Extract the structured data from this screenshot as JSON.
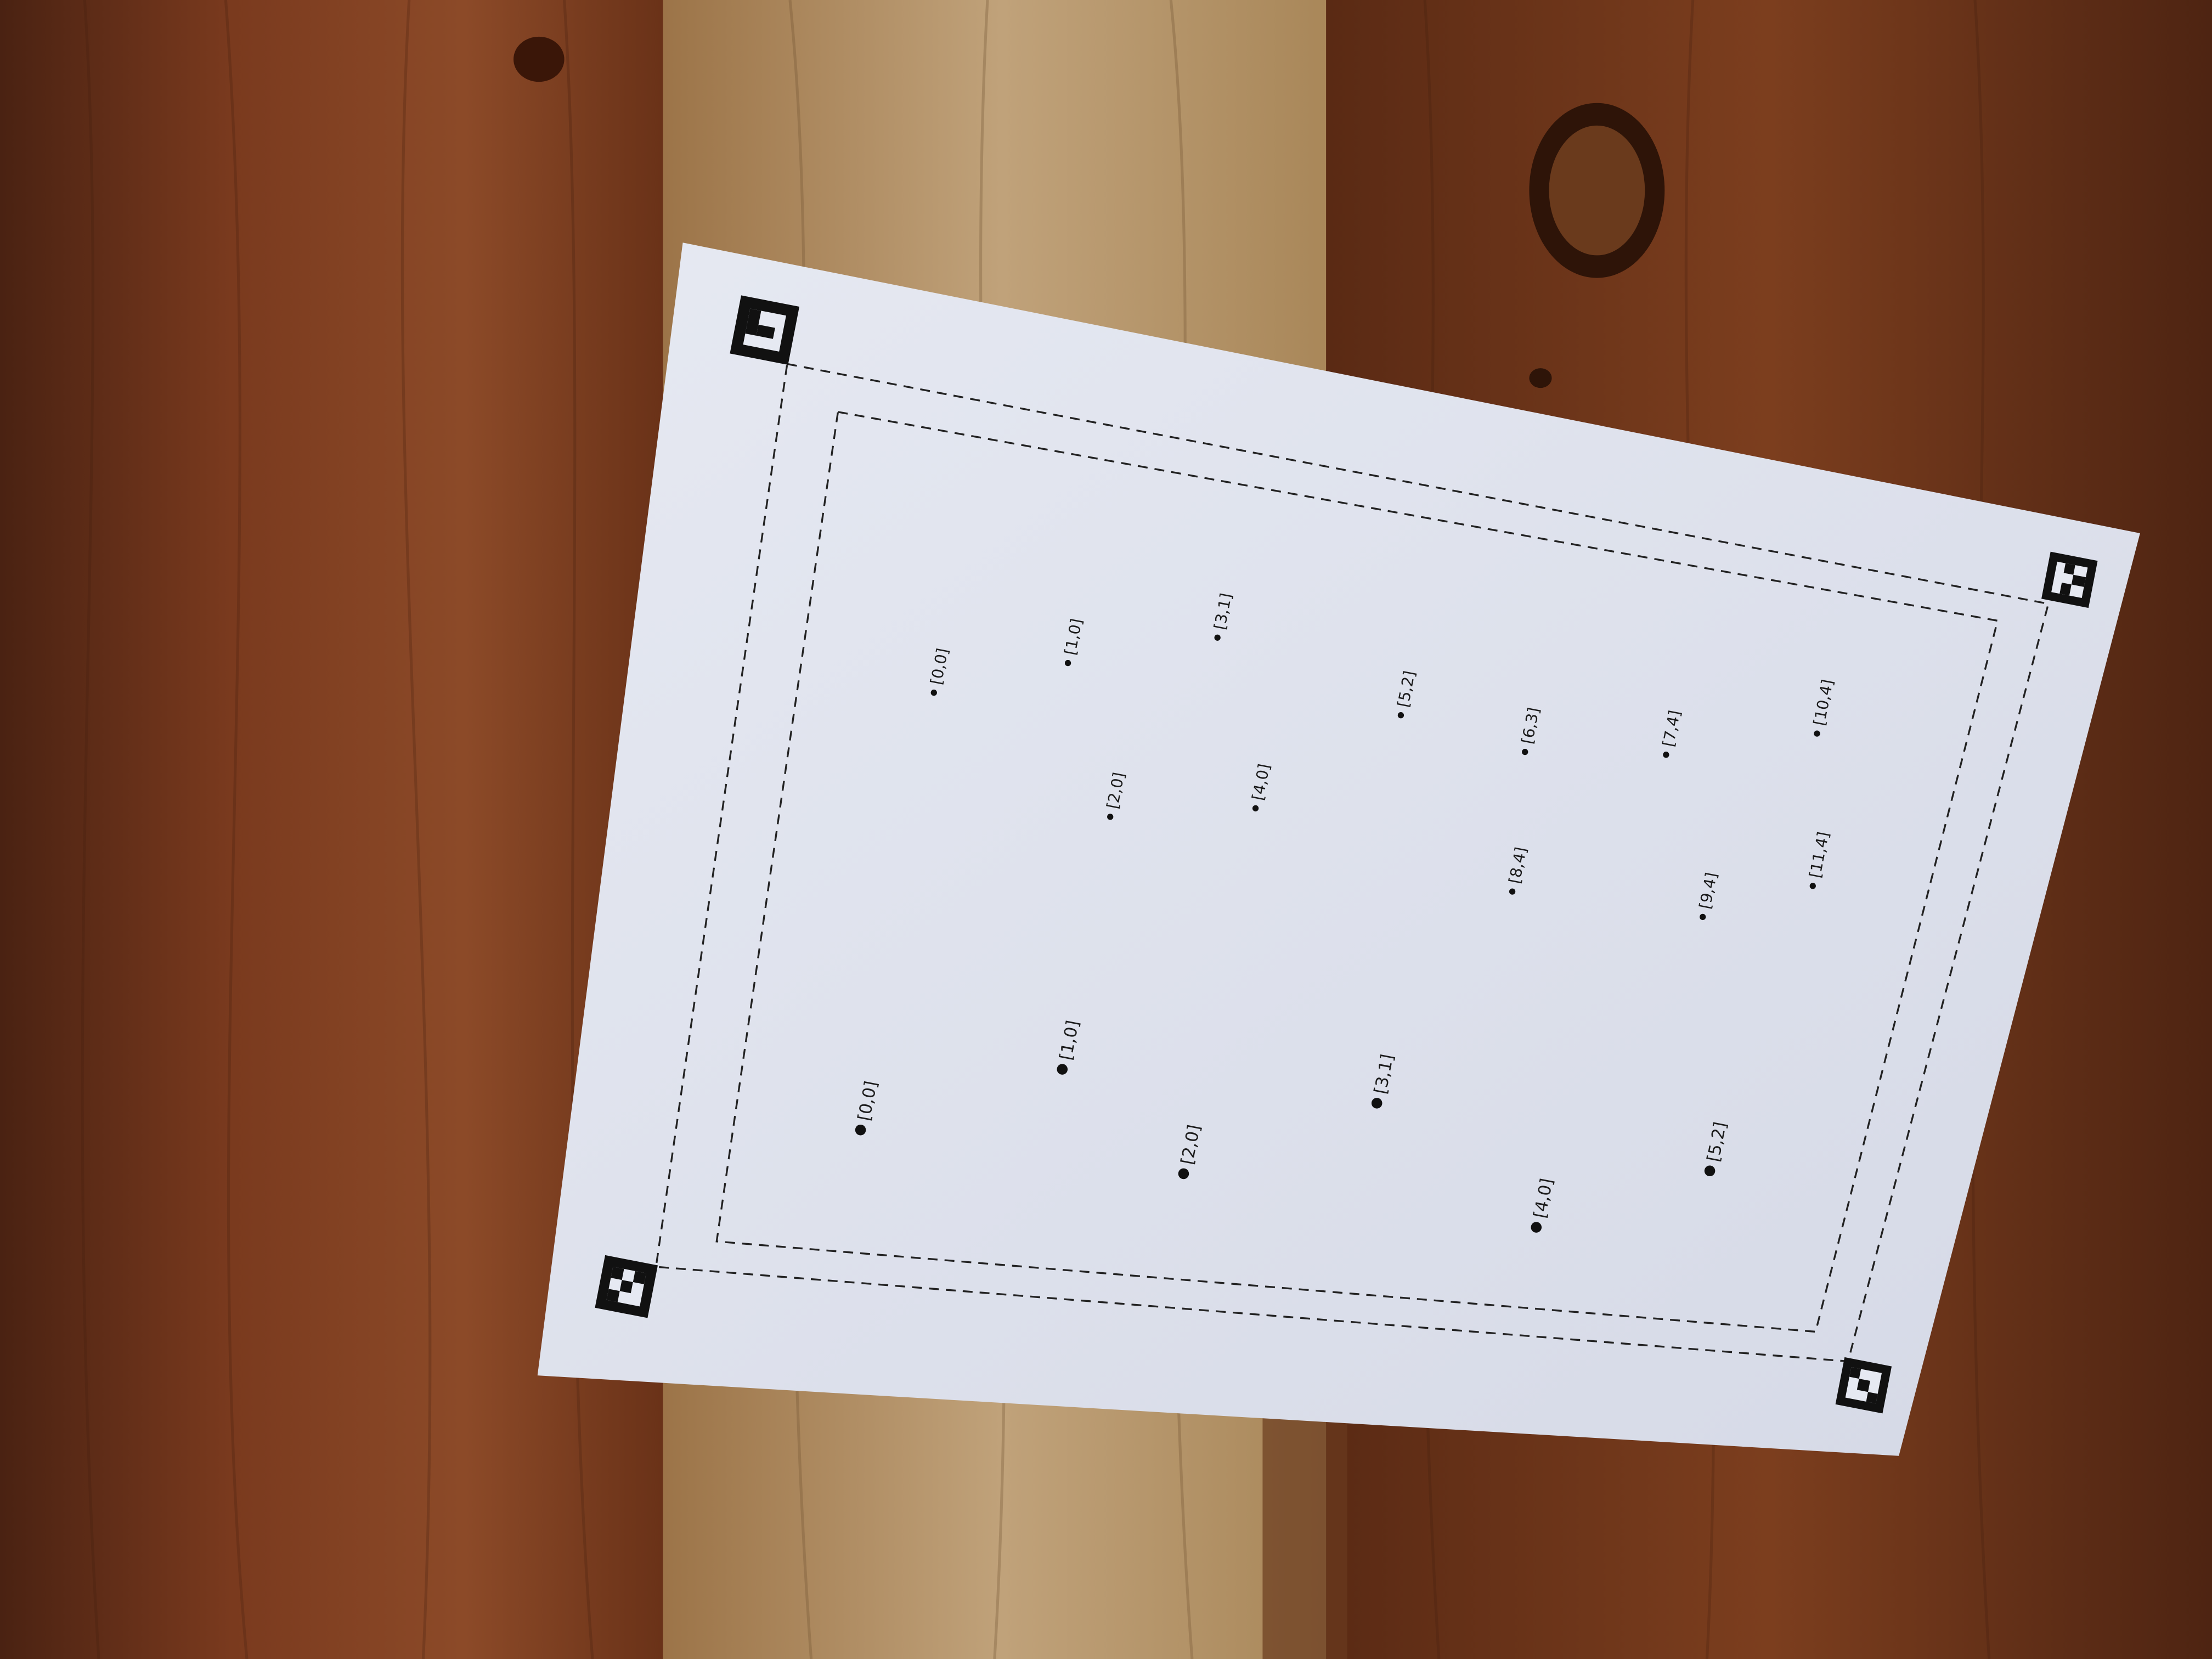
{
  "scene": {
    "colors": {
      "wood_dark": "#5a2a16",
      "wood_mid": "#8a4a2a",
      "wood_light": "#b08a60",
      "paper": "#dfe3ee",
      "ink": "#151515"
    },
    "markers": [
      {
        "name": "fiducial-top-left",
        "pattern": "corner-L"
      },
      {
        "name": "fiducial-top-right",
        "pattern": "corner-dots"
      },
      {
        "name": "fiducial-bottom-left",
        "pattern": "checker"
      },
      {
        "name": "fiducial-bottom-right",
        "pattern": "checker-small"
      }
    ],
    "small_points": [
      {
        "label": "[0,0]"
      },
      {
        "label": "[1,0]"
      },
      {
        "label": "[3,1]"
      },
      {
        "label": "[5,2]"
      },
      {
        "label": "[6,3]"
      },
      {
        "label": "[7,4]"
      },
      {
        "label": "[10,4]"
      },
      {
        "label": "[2,0]"
      },
      {
        "label": "[4,0]"
      },
      {
        "label": "[8,4]"
      },
      {
        "label": "[9,4]"
      },
      {
        "label": "[11,4]"
      }
    ],
    "large_points": [
      {
        "label": "[0,0]"
      },
      {
        "label": "[1,0]"
      },
      {
        "label": "[2,0]"
      },
      {
        "label": "[3,1]"
      },
      {
        "label": "[4,0]"
      },
      {
        "label": "[5,2]"
      }
    ]
  }
}
